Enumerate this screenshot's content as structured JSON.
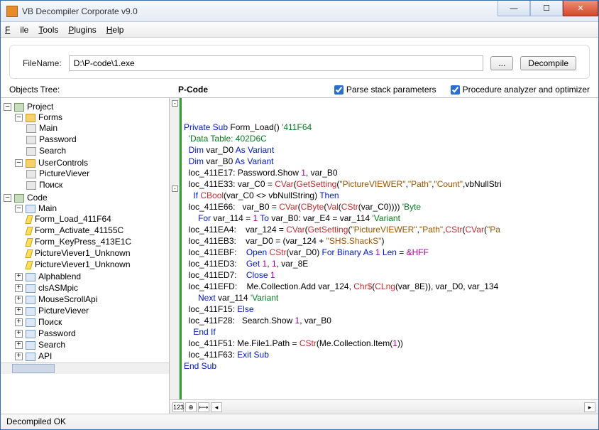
{
  "window": {
    "title": "VB Decompiler Corporate v9.0"
  },
  "menu": {
    "file": "File",
    "tools": "Tools",
    "plugins": "Plugins",
    "help": "Help"
  },
  "file": {
    "label": "FileName:",
    "value": "D:\\P-code\\1.exe",
    "browse": "...",
    "decompile": "Decompile"
  },
  "labels": {
    "objects": "Objects Tree:",
    "pcode": "P-Code",
    "parse": "Parse stack parameters",
    "proc": "Procedure analyzer and optimizer"
  },
  "tree": {
    "project": "Project",
    "forms": "Forms",
    "forms_items": [
      "Main",
      "Password",
      "Search"
    ],
    "uc": "UserControls",
    "uc_items": [
      "PictureViever",
      "Поиск"
    ],
    "code": "Code",
    "main": "Main",
    "main_items": [
      "Form_Load_411F64",
      "Form_Activate_41155C",
      "Form_KeyPress_413E1C",
      "PictureViever1_Unknown",
      "PictureViever1_Unknown"
    ],
    "mods": [
      "Alphablend",
      "clsASMpic",
      "MouseScrollApi",
      "PictureViever",
      "Поиск",
      "Password",
      "Search",
      "API"
    ]
  },
  "code": {
    "l1a": "Private Sub",
    "l1b": " Form_Load() ",
    "l1c": "'411F64",
    "l2": "  'Data Table: 402D6C",
    "l3a": "  Dim",
    "l3b": " var_D0 ",
    "l3c": "As Variant",
    "l4a": "  Dim",
    "l4b": " var_B0 ",
    "l4c": "As Variant",
    "l5a": "  loc_411E17: Password.Show ",
    "l5b": "1",
    "l5c": ", var_B0",
    "l6a": "  loc_411E33: var_C0 = ",
    "l6b": "CVar",
    "l6c": "(",
    "l6d": "GetSetting",
    "l6e": "(",
    "l6f": "\"PictureVIEWER\"",
    "l6g": ",",
    "l6h": "\"Path\"",
    "l6i": ",",
    "l6j": "\"Count\"",
    "l6k": ",vbNullStri",
    "l7a": "    If ",
    "l7b": "CBool",
    "l7c": "(var_C0 <> vbNullString) ",
    "l7d": "Then",
    "l8a": "  loc_411E66:   var_B0 = ",
    "l8b": "CVar",
    "l8c": "(",
    "l8d": "CByte",
    "l8e": "(",
    "l8f": "Val",
    "l8g": "(",
    "l8h": "CStr",
    "l8i": "(var_C0)))) ",
    "l8j": "'Byte",
    "l9a": "      For",
    "l9b": " var_114 = ",
    "l9c": "1",
    "l9d": " To",
    "l9e": " var_B0: var_E4 = var_114 ",
    "l9f": "'Variant",
    "l10a": "  loc_411EA4:    var_124 = ",
    "l10b": "CVar",
    "l10c": "(",
    "l10d": "GetSetting",
    "l10e": "(",
    "l10f": "\"PictureVIEWER\"",
    "l10g": ",",
    "l10h": "\"Path\"",
    "l10i": ",",
    "l10j": "CStr",
    "l10k": "(",
    "l10l": "CVar",
    "l10m": "(",
    "l10n": "\"Pa",
    "l11a": "  loc_411EB3:    var_D0 = (var_124 + ",
    "l11b": "\"SHS.ShackS\"",
    "l11c": ")",
    "l12a": "  loc_411EBF:    ",
    "l12b": "Open ",
    "l12c": "CStr",
    "l12d": "(var_D0) ",
    "l12e": "For Binary As ",
    "l12f": "1",
    "l12g": " Len",
    "l12h": " = ",
    "l12i": "&HFF",
    "l13a": "  loc_411ED3:    ",
    "l13b": "Get ",
    "l13c": "1",
    "l13d": ", ",
    "l13e": "1",
    "l13f": ", var_8E",
    "l14a": "  loc_411ED7:    ",
    "l14b": "Close ",
    "l14c": "1",
    "l15a": "  loc_411EFD:    Me.Collection.Add var_124, ",
    "l15b": "Chr$",
    "l15c": "(",
    "l15d": "CLng",
    "l15e": "(var_8E)), var_D0, var_134",
    "l16a": "      Next",
    "l16b": " var_114 ",
    "l16c": "'Variant",
    "l17a": "  loc_411F15: ",
    "l17b": "Else",
    "l18a": "  loc_411F28:   Search.Show ",
    "l18b": "1",
    "l18c": ", var_B0",
    "l19": "    End If",
    "l20a": "  loc_411F51: Me.File1.Path = ",
    "l20b": "CStr",
    "l20c": "(Me.Collection.Item(",
    "l20d": "1",
    "l20e": "))",
    "l21a": "  loc_411F63: ",
    "l21b": "Exit Sub",
    "l22": "End Sub"
  },
  "status": "Decompiled OK"
}
